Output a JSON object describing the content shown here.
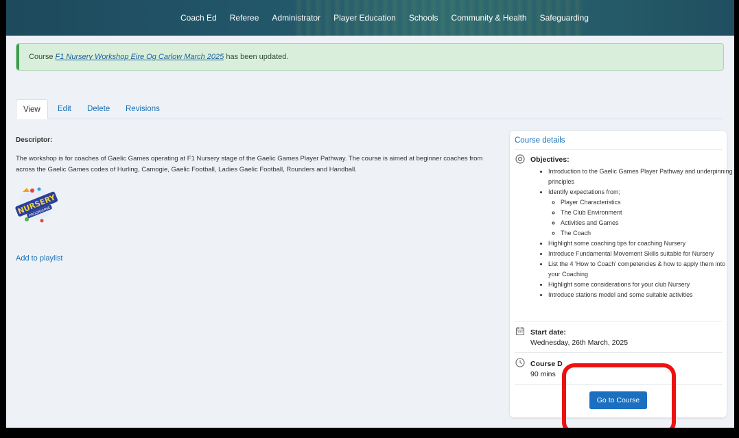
{
  "nav": {
    "items": [
      "Coach Ed",
      "Referee",
      "Administrator",
      "Player Education",
      "Schools",
      "Community & Health",
      "Safeguarding"
    ]
  },
  "alert": {
    "prefix": "Course ",
    "link": "F1 Nursery Workshop Eire Og Carlow March 2025",
    "suffix": " has been updated."
  },
  "tabs": [
    "View",
    "Edit",
    "Delete",
    "Revisions"
  ],
  "descriptor": {
    "label": "Descriptor:",
    "text": "The workshop is for coaches of Gaelic Games operating at F1 Nursery stage of the Gaelic Games Player Pathway. The course is aimed at beginner coaches from across the Gaelic Games codes of Hurling, Camogie, Gaelic Football, Ladies Gaelic Football, Rounders and Handball."
  },
  "logo": {
    "main": "NURSERY",
    "sub": "PROGRAMME"
  },
  "add_to_playlist": "Add to playlist",
  "card": {
    "title": "Course details",
    "objectives_label": "Objectives:",
    "objectives": [
      "Introduction to the Gaelic Games Player Pathway and underpinning principles",
      "Identify expectations from;",
      "Highlight some coaching tips for coaching Nursery",
      "Introduce Fundamental Movement Skills suitable for Nursery",
      "List the 4 'How to Coach' competencies & how to apply them into your Coaching",
      "Highlight some considerations for your club Nursery",
      "Introduce stations model and some suitable activities"
    ],
    "sub_objectives": [
      "Player Characteristics",
      "The Club Environment",
      "Activities and Games",
      "The Coach"
    ],
    "start_label": "Start date:",
    "start_value": "Wednesday, 26th March, 2025",
    "duration_label": "Course D",
    "duration_value": "90 mins",
    "button": "Go to Course"
  },
  "colors": {
    "nav_bg": "#1d4a5c",
    "link": "#1a6fb5",
    "alert_bg": "#d9eedb",
    "button": "#1a6fc0",
    "annotation": "#ee1111"
  }
}
